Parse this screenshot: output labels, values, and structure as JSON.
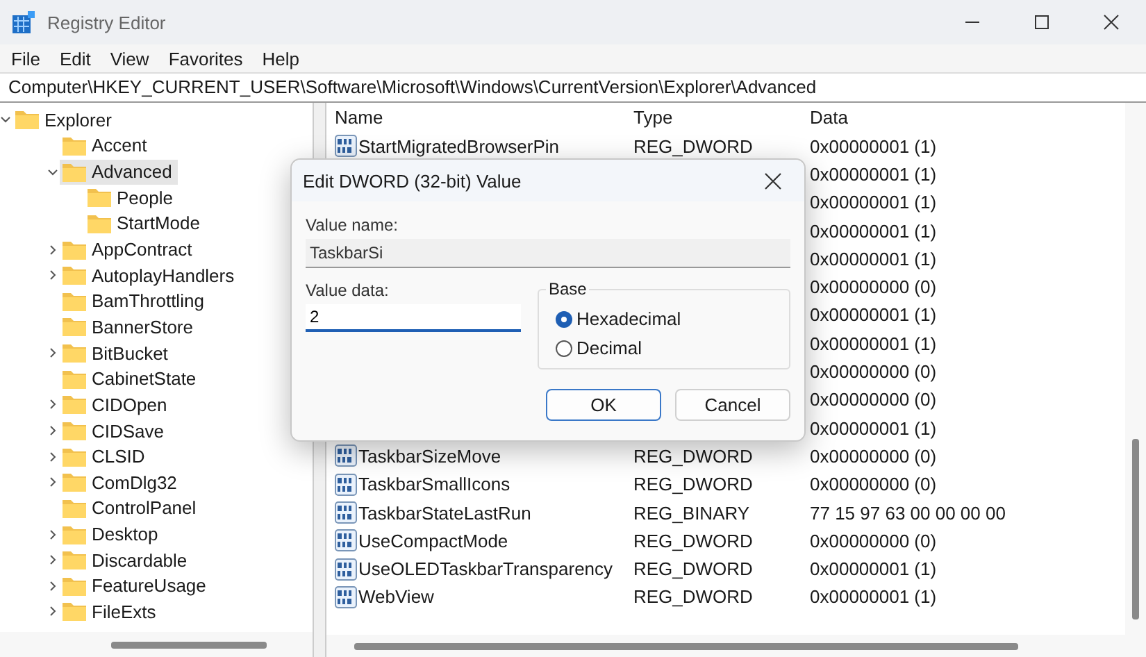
{
  "window": {
    "title": "Registry Editor"
  },
  "menu": [
    "File",
    "Edit",
    "View",
    "Favorites",
    "Help"
  ],
  "address": "Computer\\HKEY_CURRENT_USER\\Software\\Microsoft\\Windows\\CurrentVersion\\Explorer\\Advanced",
  "tree": [
    {
      "label": "Explorer",
      "expanded": true,
      "selected": false,
      "children": [
        {
          "label": "Accent",
          "selected": false
        },
        {
          "label": "Advanced",
          "expanded": true,
          "selected": true,
          "children": [
            {
              "label": "People",
              "selected": false
            },
            {
              "label": "StartMode",
              "selected": false
            }
          ]
        },
        {
          "label": "AppContract",
          "expanded": false,
          "selected": false
        },
        {
          "label": "AutoplayHandlers",
          "expanded": false,
          "selected": false
        },
        {
          "label": "BamThrottling",
          "selected": false
        },
        {
          "label": "BannerStore",
          "selected": false
        },
        {
          "label": "BitBucket",
          "expanded": false,
          "selected": false
        },
        {
          "label": "CabinetState",
          "selected": false
        },
        {
          "label": "CIDOpen",
          "expanded": false,
          "selected": false
        },
        {
          "label": "CIDSave",
          "expanded": false,
          "selected": false
        },
        {
          "label": "CLSID",
          "expanded": false,
          "selected": false
        },
        {
          "label": "ComDlg32",
          "expanded": false,
          "selected": false
        },
        {
          "label": "ControlPanel",
          "selected": false
        },
        {
          "label": "Desktop",
          "expanded": false,
          "selected": false
        },
        {
          "label": "Discardable",
          "expanded": false,
          "selected": false
        },
        {
          "label": "FeatureUsage",
          "expanded": false,
          "selected": false
        },
        {
          "label": "FileExts",
          "expanded": false,
          "selected": false
        }
      ]
    }
  ],
  "list": {
    "columns": [
      "Name",
      "Type",
      "Data"
    ],
    "rows": [
      {
        "name": "StartMigratedBrowserPin",
        "type": "REG_DWORD",
        "data": "0x00000001 (1)"
      },
      {
        "data": "0x00000001 (1)"
      },
      {
        "data": "0x00000001 (1)"
      },
      {
        "data": "0x00000001 (1)"
      },
      {
        "data": "0x00000001 (1)"
      },
      {
        "data": "0x00000000 (0)"
      },
      {
        "data": "0x00000001 (1)"
      },
      {
        "data": "0x00000001 (1)"
      },
      {
        "data": "0x00000000 (0)"
      },
      {
        "data": "0x00000000 (0)"
      },
      {
        "data": "0x00000001 (1)"
      },
      {
        "name": "TaskbarSizeMove",
        "type": "REG_DWORD",
        "data": "0x00000000 (0)"
      },
      {
        "name": "TaskbarSmallIcons",
        "type": "REG_DWORD",
        "data": "0x00000000 (0)"
      },
      {
        "name": "TaskbarStateLastRun",
        "type": "REG_BINARY",
        "data": "77 15 97 63 00 00 00 00"
      },
      {
        "name": "UseCompactMode",
        "type": "REG_DWORD",
        "data": "0x00000000 (0)"
      },
      {
        "name": "UseOLEDTaskbarTransparency",
        "type": "REG_DWORD",
        "data": "0x00000001 (1)"
      },
      {
        "name": "WebView",
        "type": "REG_DWORD",
        "data": "0x00000001 (1)"
      }
    ]
  },
  "dialog": {
    "title": "Edit DWORD (32-bit) Value",
    "value_name_label": "Value name:",
    "value_name": "TaskbarSi",
    "value_data_label": "Value data:",
    "value_data": "2",
    "base": {
      "label": "Base",
      "options": [
        {
          "label": "Hexadecimal",
          "selected": true
        },
        {
          "label": "Decimal",
          "selected": false
        }
      ]
    },
    "buttons": [
      {
        "label": "OK",
        "focused": true
      },
      {
        "label": "Cancel",
        "focused": false
      }
    ]
  }
}
